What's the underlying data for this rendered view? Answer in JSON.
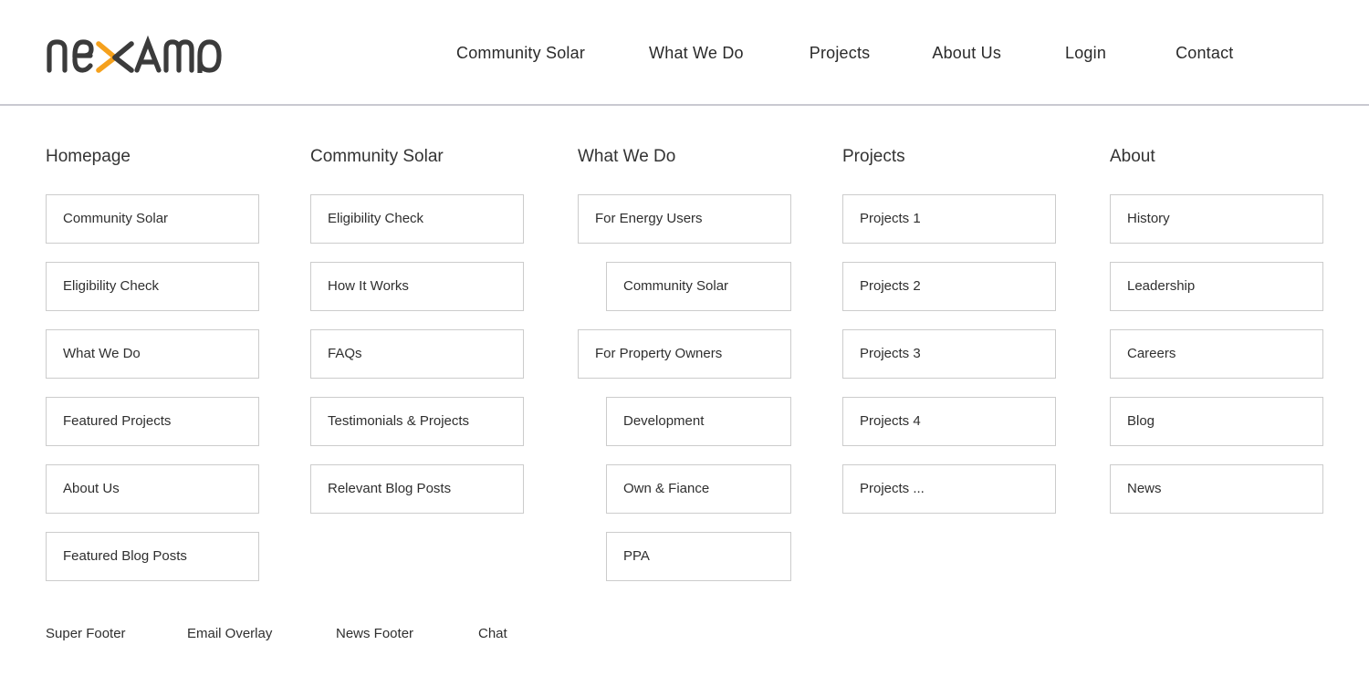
{
  "header": {
    "logo": {
      "name": "nexamp",
      "text_color": "#3b3b3b",
      "accent_color": "#f5a11d"
    },
    "nav": [
      {
        "label": "Community Solar"
      },
      {
        "label": "What We Do"
      },
      {
        "label": "Projects"
      },
      {
        "label": "About Us"
      },
      {
        "label": "Login"
      },
      {
        "label": "Contact"
      }
    ]
  },
  "sitemap": {
    "border_color": "#cccccc",
    "columns": [
      {
        "title": "Homepage",
        "nodes": [
          {
            "label": "Community Solar",
            "indent": false
          },
          {
            "label": "Eligibility Check",
            "indent": false
          },
          {
            "label": "What We Do",
            "indent": false
          },
          {
            "label": "Featured Projects",
            "indent": false
          },
          {
            "label": "About Us",
            "indent": false
          },
          {
            "label": "Featured Blog Posts",
            "indent": false
          }
        ]
      },
      {
        "title": "Community Solar",
        "nodes": [
          {
            "label": "Eligibility Check",
            "indent": false
          },
          {
            "label": "How It Works",
            "indent": false
          },
          {
            "label": "FAQs",
            "indent": false
          },
          {
            "label": "Testimonials & Projects",
            "indent": false
          },
          {
            "label": "Relevant Blog Posts",
            "indent": false
          }
        ]
      },
      {
        "title": "What We Do",
        "nodes": [
          {
            "label": "For Energy Users",
            "indent": false
          },
          {
            "label": "Community Solar",
            "indent": true
          },
          {
            "label": "For Property Owners",
            "indent": false
          },
          {
            "label": "Development",
            "indent": true
          },
          {
            "label": "Own & Fiance",
            "indent": true
          },
          {
            "label": "PPA",
            "indent": true
          }
        ]
      },
      {
        "title": "Projects",
        "nodes": [
          {
            "label": "Projects 1",
            "indent": false
          },
          {
            "label": "Projects 2",
            "indent": false
          },
          {
            "label": "Projects 3",
            "indent": false
          },
          {
            "label": "Projects 4",
            "indent": false
          },
          {
            "label": "Projects ...",
            "indent": false
          }
        ]
      },
      {
        "title": "About",
        "nodes": [
          {
            "label": "History",
            "indent": false
          },
          {
            "label": "Leadership",
            "indent": false
          },
          {
            "label": "Careers",
            "indent": false
          },
          {
            "label": "Blog",
            "indent": false
          },
          {
            "label": "News",
            "indent": false
          }
        ]
      }
    ]
  },
  "footer": {
    "links": [
      {
        "label": "Super Footer"
      },
      {
        "label": "Email Overlay"
      },
      {
        "label": "News Footer"
      },
      {
        "label": "Chat"
      }
    ]
  }
}
